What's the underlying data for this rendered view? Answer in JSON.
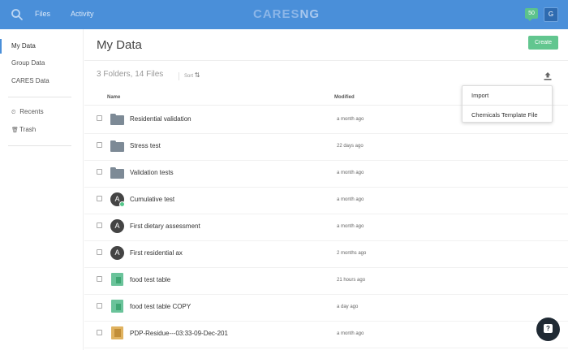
{
  "topbar": {
    "nav": [
      {
        "label": "Files"
      },
      {
        "label": "Activity"
      }
    ],
    "brand_main": "CARES",
    "brand_suffix": "NG",
    "notification_count": "50",
    "user_initial": "G",
    "colors": {
      "bar": "#4a8fd9"
    }
  },
  "sidebar": {
    "items": [
      {
        "label": "My Data",
        "active": true
      },
      {
        "label": "Group Data"
      },
      {
        "label": "CARES Data"
      }
    ],
    "tools": [
      {
        "label": "Recents",
        "icon": "clock-icon"
      },
      {
        "label": "Trash",
        "icon": "trash-icon"
      }
    ]
  },
  "main": {
    "title": "My Data",
    "create_label": "Create",
    "summary": "3 Folders, 14 Files",
    "sort_label": "Sort",
    "columns": {
      "name": "Name",
      "modified": "Modified"
    },
    "files": [
      {
        "name": "Residential validation",
        "modified": "a month ago",
        "icon": "folder-icon"
      },
      {
        "name": "Stress test",
        "modified": "22 days ago",
        "icon": "folder-icon"
      },
      {
        "name": "Validation tests",
        "modified": "a month ago",
        "icon": "folder-icon"
      },
      {
        "name": "Cumulative test",
        "modified": "a month ago",
        "icon": "assessment-shared-icon"
      },
      {
        "name": "First dietary assessment",
        "modified": "a month ago",
        "icon": "assessment-icon"
      },
      {
        "name": "First residential ax",
        "modified": "2 months ago",
        "icon": "assessment-icon"
      },
      {
        "name": "food test table",
        "modified": "21 hours ago",
        "icon": "table-icon"
      },
      {
        "name": "food test table COPY",
        "modified": "a day ago",
        "icon": "table-icon"
      },
      {
        "name": "PDP-Residue---03:33-09-Dec-201",
        "modified": "a month ago",
        "icon": "pdp-file-icon"
      }
    ]
  },
  "dropdown": {
    "items": [
      {
        "label": "Import"
      },
      {
        "label": "Chemicals Template File"
      }
    ]
  },
  "chat": {
    "icon": "chat-icon",
    "glyph": "?"
  }
}
